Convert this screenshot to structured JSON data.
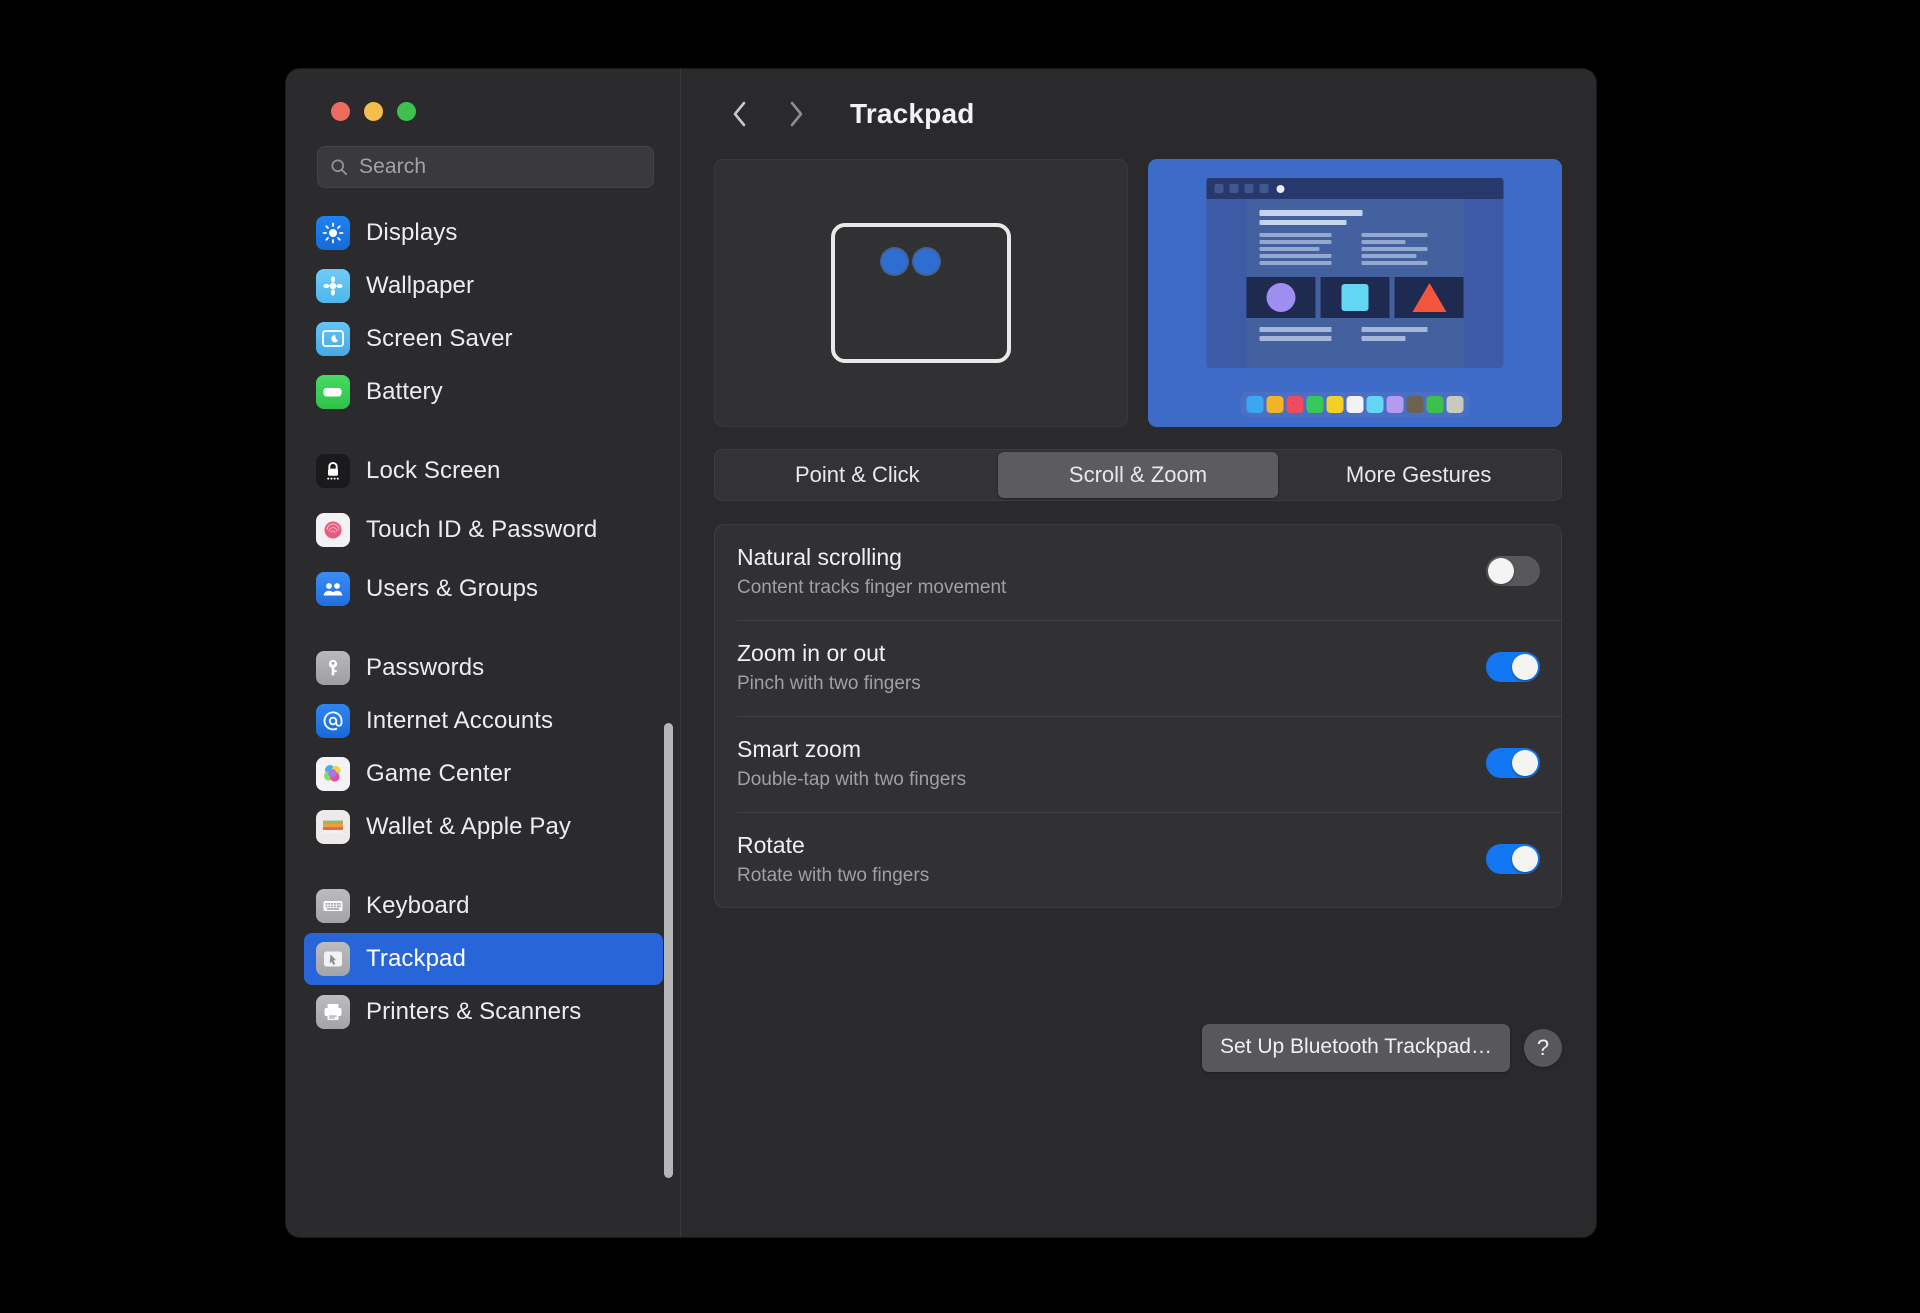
{
  "window": {
    "traffic_lights": [
      {
        "name": "close",
        "color": "#ef6a5e"
      },
      {
        "name": "minimize",
        "color": "#f4bd4e"
      },
      {
        "name": "zoom",
        "color": "#3fc14c"
      }
    ]
  },
  "search": {
    "placeholder": "Search",
    "value": "",
    "icon": "search-icon"
  },
  "sidebar": {
    "groups": [
      {
        "items": [
          {
            "label": "Displays",
            "icon": "displays-icon",
            "selected": false
          },
          {
            "label": "Wallpaper",
            "icon": "wallpaper-icon",
            "selected": false
          },
          {
            "label": "Screen Saver",
            "icon": "screen-saver-icon",
            "selected": false
          },
          {
            "label": "Battery",
            "icon": "battery-icon",
            "selected": false
          }
        ]
      },
      {
        "items": [
          {
            "label": "Lock Screen",
            "icon": "lock-icon",
            "selected": false
          },
          {
            "label": "Touch ID & Password",
            "icon": "touch-id-icon",
            "selected": false
          },
          {
            "label": "Users & Groups",
            "icon": "users-icon",
            "selected": false
          }
        ]
      },
      {
        "items": [
          {
            "label": "Passwords",
            "icon": "key-icon",
            "selected": false
          },
          {
            "label": "Internet Accounts",
            "icon": "at-sign-icon",
            "selected": false
          },
          {
            "label": "Game Center",
            "icon": "game-center-icon",
            "selected": false
          },
          {
            "label": "Wallet & Apple Pay",
            "icon": "wallet-icon",
            "selected": false
          }
        ]
      },
      {
        "items": [
          {
            "label": "Keyboard",
            "icon": "keyboard-icon",
            "selected": false
          },
          {
            "label": "Trackpad",
            "icon": "trackpad-icon",
            "selected": true
          },
          {
            "label": "Printers & Scanners",
            "icon": "printer-icon",
            "selected": false
          }
        ]
      }
    ],
    "scrollbar_visible": true
  },
  "toolbar": {
    "back_icon": "chevron-left-icon",
    "forward_icon": "chevron-right-icon",
    "title": "Trackpad"
  },
  "preview": {
    "gesture_illustration": "two-finger-trackpad-illustration",
    "animation_label": "scroll-zoom-animation",
    "dock_colors": [
      "#3aa7f0",
      "#f0b429",
      "#ef4a5e",
      "#38c85a",
      "#f2d028",
      "#f2f2f4",
      "#63d6f3",
      "#b49bef",
      "#6b6350",
      "#3ec04c",
      "#c9c9bd"
    ]
  },
  "tabs": {
    "items": [
      {
        "label": "Point & Click",
        "active": false
      },
      {
        "label": "Scroll & Zoom",
        "active": true
      },
      {
        "label": "More Gestures",
        "active": false
      }
    ]
  },
  "settings": {
    "rows": [
      {
        "title": "Natural scrolling",
        "subtitle": "Content tracks finger movement",
        "enabled": false
      },
      {
        "title": "Zoom in or out",
        "subtitle": "Pinch with two fingers",
        "enabled": true
      },
      {
        "title": "Smart zoom",
        "subtitle": "Double-tap with two fingers",
        "enabled": true
      },
      {
        "title": "Rotate",
        "subtitle": "Rotate with two fingers",
        "enabled": true
      }
    ]
  },
  "footer": {
    "setup_button": "Set Up Bluetooth Trackpad…",
    "help_button": "?"
  },
  "colors": {
    "accent": "#1277f2",
    "selection": "#2765d9",
    "window_bg": "#2a2a2c",
    "panel_bg": "#313133",
    "desktop_bg": "#000000"
  }
}
